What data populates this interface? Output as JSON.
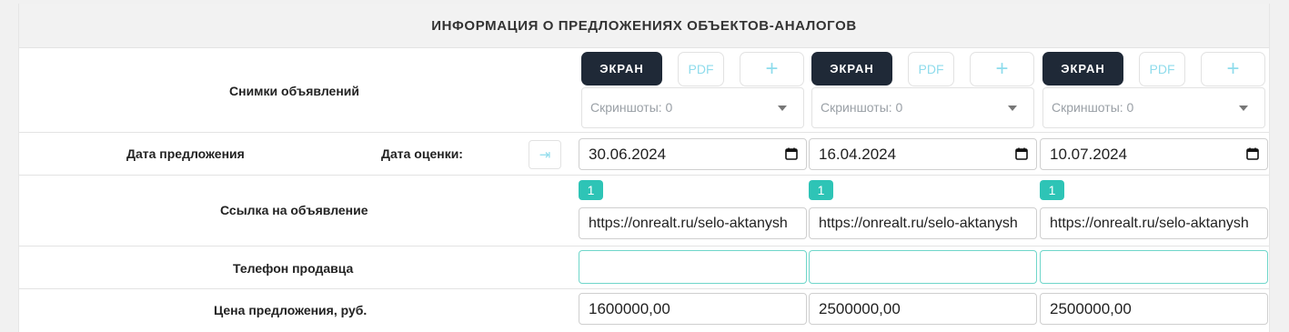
{
  "header": {
    "title": "ИНФОРМАЦИЯ О ПРЕДЛОЖЕНИЯХ ОБЪЕКТОВ-АНАЛОГОВ"
  },
  "rows": {
    "screenshots_label": "Снимки объявлений",
    "offer_date_label": "Дата предложения",
    "valuation_date_label": "Дата оценки:",
    "link_label": "Ссылка на объявление",
    "phone_label": "Телефон продавца",
    "price_label": "Цена предложения, руб."
  },
  "analogs": [
    {
      "screen_label": "ЭКРАН",
      "pdf_label": "PDF",
      "add_label": "+",
      "screens_placeholder": "Скриншоты: 0",
      "date": "30.06.2024",
      "link_count": "1",
      "link": "https://onrealt.ru/selo-aktanysh",
      "phone": "",
      "price": "1600000,00"
    },
    {
      "screen_label": "ЭКРАН",
      "pdf_label": "PDF",
      "add_label": "+",
      "screens_placeholder": "Скриншоты: 0",
      "date": "16.04.2024",
      "link_count": "1",
      "link": "https://onrealt.ru/selo-aktanysh",
      "phone": "",
      "price": "2500000,00"
    },
    {
      "screen_label": "ЭКРАН",
      "pdf_label": "PDF",
      "add_label": "+",
      "screens_placeholder": "Скриншоты: 0",
      "date": "10.07.2024",
      "link_count": "1",
      "link": "https://onrealt.ru/selo-aktanysh",
      "phone": "",
      "price": "2500000,00"
    }
  ],
  "icons": {
    "calendar": "calendar-icon",
    "arrow": "arrow-right-to-line-icon"
  },
  "colors": {
    "dark_button": "#1f2937",
    "accent": "#2ec4b6",
    "accent_light": "#8fdcec"
  }
}
